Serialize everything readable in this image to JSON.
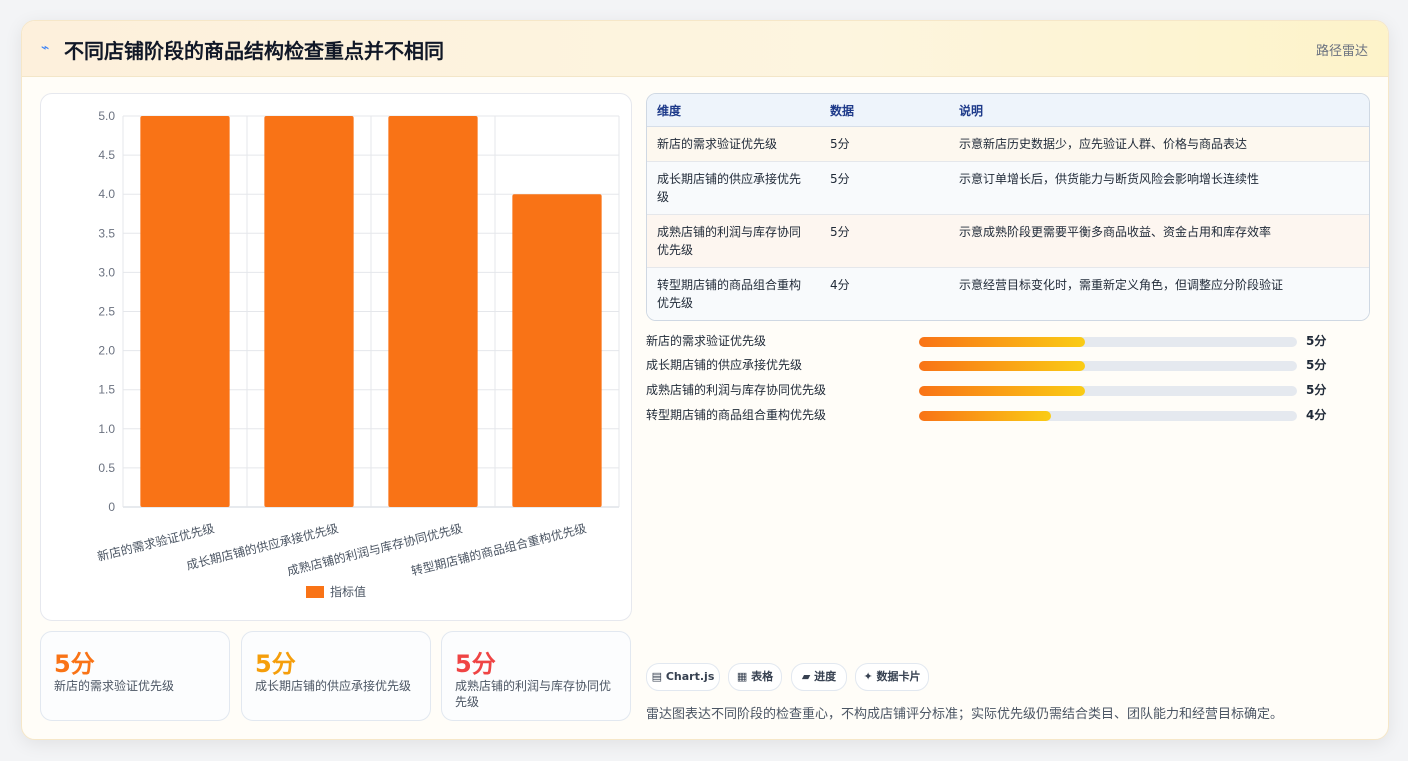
{
  "header": {
    "icon": "sparkle-icon",
    "title": "不同店铺阶段的商品结构检查重点并不相同",
    "tag": "路径雷达"
  },
  "chart_data": {
    "type": "bar",
    "categories": [
      "新店的需求验证优先级",
      "成长期店铺的供应承接优先级",
      "成熟店铺的利润与库存协同优先级",
      "转型期店铺的商品组合重构优先级"
    ],
    "series": [
      {
        "name": "指标值",
        "values": [
          5,
          5,
          5,
          4
        ],
        "color": "#f97316"
      }
    ],
    "ylim": [
      0,
      5
    ],
    "yticks": [
      "0",
      "0.5",
      "1.0",
      "1.5",
      "2.0",
      "2.5",
      "3.0",
      "3.5",
      "4.0",
      "4.5",
      "5.0"
    ],
    "grid": true,
    "legend": "bottom"
  },
  "stats": [
    {
      "value": "5分",
      "label": "新店的需求验证优先级",
      "color": "#f97316"
    },
    {
      "value": "5分",
      "label": "成长期店铺的供应承接优先级",
      "color": "#f59e0b"
    },
    {
      "value": "5分",
      "label": "成熟店铺的利润与库存协同优先级",
      "color": "#ef4444"
    }
  ],
  "table": {
    "headers": [
      "维度",
      "数据",
      "说明"
    ],
    "rows": [
      [
        "新店的需求验证优先级",
        "5分",
        "示意新店历史数据少，应先验证人群、价格与商品表达"
      ],
      [
        "成长期店铺的供应承接优先级",
        "5分",
        "示意订单增长后，供货能力与断货风险会影响增长连续性"
      ],
      [
        "成熟店铺的利润与库存协同优先级",
        "5分",
        "示意成熟阶段更需要平衡多商品收益、资金占用和库存效率"
      ],
      [
        "转型期店铺的商品组合重构优先级",
        "4分",
        "示意经营目标变化时，需重新定义角色，但调整应分阶段验证"
      ]
    ]
  },
  "progress": [
    {
      "label": "新店的需求验证优先级",
      "value": "5分",
      "fraction": 0.44
    },
    {
      "label": "成长期店铺的供应承接优先级",
      "value": "5分",
      "fraction": 0.44
    },
    {
      "label": "成熟店铺的利润与库存协同优先级",
      "value": "5分",
      "fraction": 0.44
    },
    {
      "label": "转型期店铺的商品组合重构优先级",
      "value": "4分",
      "fraction": 0.35
    }
  ],
  "chips": [
    {
      "icon": "chart-icon",
      "glyph": "▤",
      "label": "Chart.js"
    },
    {
      "icon": "table-icon",
      "glyph": "▦",
      "label": "表格"
    },
    {
      "icon": "progress-icon",
      "glyph": "▰",
      "label": "进度"
    },
    {
      "icon": "sparkle-icon",
      "glyph": "✦",
      "label": "数据卡片"
    }
  ],
  "footnote": "雷达图表达不同阶段的检查重心，不构成店铺评分标准；实际优先级仍需结合类目、团队能力和经营目标确定。"
}
